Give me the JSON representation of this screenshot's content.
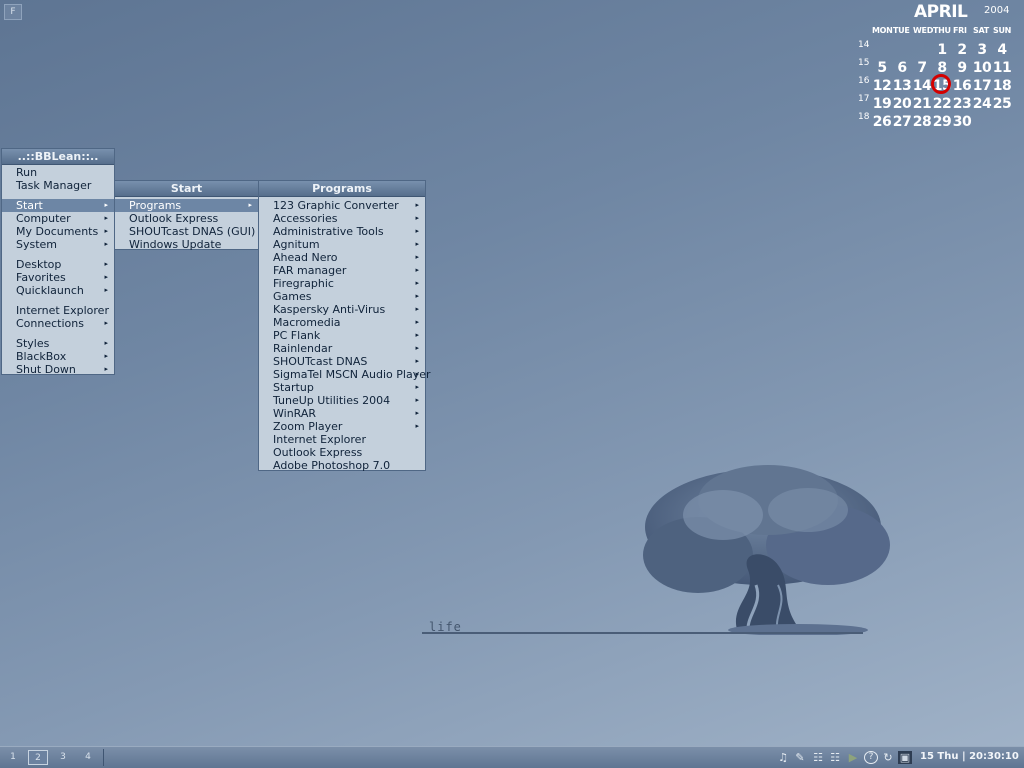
{
  "corner_button": "F",
  "bblean_menu": {
    "title": "..::BBLean::..",
    "groups": [
      [
        {
          "label": "Run"
        },
        {
          "label": "Task Manager"
        }
      ],
      [
        {
          "label": "Start",
          "submenu": true,
          "active": true
        },
        {
          "label": "Computer",
          "submenu": true
        },
        {
          "label": "My Documents",
          "submenu": true
        },
        {
          "label": "System",
          "submenu": true
        }
      ],
      [
        {
          "label": "Desktop",
          "submenu": true
        },
        {
          "label": "Favorites",
          "submenu": true
        },
        {
          "label": "Quicklaunch",
          "submenu": true
        }
      ],
      [
        {
          "label": "Internet Explorer"
        },
        {
          "label": "Connections",
          "submenu": true
        }
      ],
      [
        {
          "label": "Styles",
          "submenu": true
        },
        {
          "label": "BlackBox",
          "submenu": true
        },
        {
          "label": "Shut Down",
          "submenu": true
        }
      ]
    ]
  },
  "start_menu": {
    "title": "Start",
    "items": [
      {
        "label": "Programs",
        "submenu": true,
        "active": true
      },
      {
        "label": "Outlook Express"
      },
      {
        "label": "SHOUTcast DNAS (GUI)"
      },
      {
        "label": "Windows Update"
      }
    ]
  },
  "programs_menu": {
    "title": "Programs",
    "items": [
      {
        "label": "123 Graphic Converter",
        "submenu": true
      },
      {
        "label": "Accessories",
        "submenu": true
      },
      {
        "label": "Administrative Tools",
        "submenu": true
      },
      {
        "label": "Agnitum",
        "submenu": true
      },
      {
        "label": "Ahead Nero",
        "submenu": true
      },
      {
        "label": "FAR manager",
        "submenu": true
      },
      {
        "label": "Firegraphic",
        "submenu": true
      },
      {
        "label": "Games",
        "submenu": true
      },
      {
        "label": "Kaspersky Anti-Virus",
        "submenu": true
      },
      {
        "label": "Macromedia",
        "submenu": true
      },
      {
        "label": "PC Flank",
        "submenu": true
      },
      {
        "label": "Rainlendar",
        "submenu": true
      },
      {
        "label": "SHOUTcast DNAS",
        "submenu": true
      },
      {
        "label": "SigmaTel MSCN Audio Player",
        "submenu": true
      },
      {
        "label": "Startup",
        "submenu": true
      },
      {
        "label": "TuneUp Utilities 2004",
        "submenu": true
      },
      {
        "label": "WinRAR",
        "submenu": true
      },
      {
        "label": "Zoom Player",
        "submenu": true
      },
      {
        "label": "Internet Explorer"
      },
      {
        "label": "Outlook Express"
      },
      {
        "label": "Adobe Photoshop 7.0"
      }
    ]
  },
  "calendar": {
    "month": "APRIL",
    "year": "2004",
    "weekdays": [
      "MON",
      "TUE",
      "WED",
      "THU",
      "FRI",
      "SAT",
      "SUN"
    ],
    "weeks": [
      {
        "num": "14",
        "days": [
          "",
          "",
          "",
          "1",
          "2",
          "3",
          "4"
        ]
      },
      {
        "num": "15",
        "days": [
          "5",
          "6",
          "7",
          "8",
          "9",
          "10",
          "11"
        ]
      },
      {
        "num": "16",
        "days": [
          "12",
          "13",
          "14",
          "15",
          "16",
          "17",
          "18"
        ]
      },
      {
        "num": "17",
        "days": [
          "19",
          "20",
          "21",
          "22",
          "23",
          "24",
          "25"
        ]
      },
      {
        "num": "18",
        "days": [
          "26",
          "27",
          "28",
          "29",
          "30",
          "",
          ""
        ]
      }
    ],
    "today": "15",
    "today_color": "#d40000"
  },
  "wallpaper": {
    "caption": "life"
  },
  "taskbar": {
    "workspaces": [
      {
        "label": "1"
      },
      {
        "label": "2",
        "active": true
      },
      {
        "label": "3"
      },
      {
        "label": "4"
      }
    ],
    "tray_icons": [
      "speaker-icon",
      "pen-icon",
      "network-icon",
      "network-icon",
      "play-icon",
      "help-icon",
      "refresh-icon",
      "app-icon"
    ],
    "clock": "15 Thu | 20:30:10"
  }
}
